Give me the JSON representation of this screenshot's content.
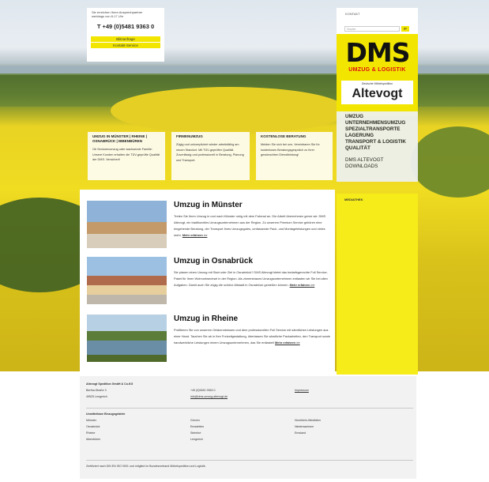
{
  "contact_box": {
    "hint_line1": "Sie erreichen Ihren Ansprechpartner",
    "hint_line2": "werktags von 8-17 Uhr",
    "phone": "T +49 (0)5481 9363 0",
    "button1": "Blitzanfrage",
    "button2": "Kontakt-Service"
  },
  "header": {
    "kontakt": "KONTAKT",
    "search_placeholder": "Suche",
    "search_button": "go"
  },
  "logo": {
    "brand": "DMS",
    "tagline": "UMZUG & LOGISTIK",
    "partner": "Deutsche Möbelspedition",
    "name": "Altevogt"
  },
  "nav": {
    "items": [
      "UMZUG",
      "UNTERNEHMENSUMZUG",
      "SPEZIALTRANSPORTE",
      "LAGERUNG",
      "TRANSPORT & LOGISTIK",
      "QUALITÄT"
    ],
    "secondary": [
      "DMS ALTEVOGT",
      "DOWNLOADS"
    ]
  },
  "teasers": [
    {
      "title": "UMZUG IN MÜNSTER | RHEINE | OSNABRÜCK | IBBENBÜREN",
      "text": "Ob Seniorenumzug oder wachsende Familie: Unsere Kunden erhalten die TÜV-geprüfte Qualität der DMS. Versichert!"
    },
    {
      "title": "FIRMENUMZUG",
      "text": "Zügig und unkompliziert wieder arbeitsfähig am neuen Standort. Mit TÜV-geprüfter Qualität. Zuverlässig und professionell in Beratung, Planung und Transport."
    },
    {
      "title": "KOSTENLOSE BERATUNG",
      "text": "Melden Sie sich bei uns. Vereinbaren Sie Ihr kostenloses Beratungsgespräch zu Ihrer gewünschten Dienstleistung!"
    }
  ],
  "stories": [
    {
      "title": "Umzug in Münster",
      "text": "Treten Sie Ihren Umzug in und nach Münster ruhig mit dem Fahrrad an. Die Arbeit übernehmen gerne wir: DMS Altevogt, ein traditionelles Umzugsunternehmen aus der Region. Zu unserem Premium Service gehören eine eingehende Beratung, der Transport Ihres Umzugsgutes, umfassende Pack- und Montageleistungen und vieles mehr.",
      "more": "Mehr erfahren >>"
    },
    {
      "title": "Umzug in Osnabrück",
      "text": "Sie planen einen Umzug mit Start oder Ziel in Osnabrück? DMS Altevogt bietet das bedarfsgerechte Full Service-Paket für Ihren Wohnortwechsel in der Region. Als zinnerstraues Umzugsunternehmen entlasten wir Sie bei allen Aufgaben. Damit auch Sie zügig die schöne Altstadt in Osnabrück genießen können.",
      "more": "Mehr erfahren >>"
    },
    {
      "title": "Umzug in Rheine",
      "text": "Profitieren Sie von unserem Ortskenntnissen und dem professionellen Full Service mit sämtlichen Leistungen aus einer Hand. Tauchen Sie ab in Ihre Freizeitgestaltung, überlassen Sie sämtliche Packarbeiten, den Transport sowie handwerkliche Leistungen einem Umzugsunternehmen, das Sie entlastet!",
      "more": "Mehr erfahren >>"
    }
  ],
  "mediathek": "MEDIATHEK",
  "footer": {
    "company": "Altevogt Spedition GmbH & Co.KG",
    "street": "Bertha-Straße 3",
    "city": "49525 Lengerich",
    "phone": "+49 (0)5481 9363 0",
    "email": "info@dms-umzug-altevogt.de",
    "impressum": "Impressum",
    "regions_title": "Unmittelbare Einzugsgebiete",
    "regions": [
      [
        "Münster",
        "Osnabrück",
        "Rheine",
        "Ibbenbüren"
      ],
      [
        "Greven",
        "Emsdetten",
        "Steinfurt",
        "Lengerich"
      ],
      [
        "Nordrhein-Westfalen",
        "Niedersachsen",
        "Emsland"
      ]
    ],
    "bottom": "Zertifiziert nach DIN EN ISO 9001 und mitglied im Bundesverband Möbelspedition und Logistik."
  }
}
